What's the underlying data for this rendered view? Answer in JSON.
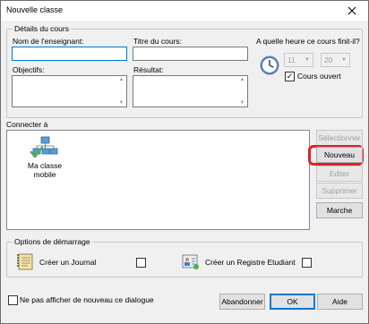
{
  "window": {
    "title": "Nouvelle classe",
    "close_icon": "close-icon"
  },
  "details": {
    "legend": "Détails du cours",
    "teacher_label": "Nom de l'enseignant:",
    "teacher_value": "",
    "course_title_label": "Titre du cours:",
    "course_title_value": "",
    "objectives_label": "Objectifs:",
    "objectives_value": "",
    "result_label": "Résultat:",
    "result_value": "",
    "end_time_label": "A quelle heure ce cours finit-il?",
    "hour_value": "11",
    "minute_value": "20",
    "course_open_label": "Cours ouvert",
    "course_open_checked": true
  },
  "connect": {
    "label": "Connecter à",
    "items": [
      {
        "label": "Ma classe mobile",
        "icon": "network-class-icon"
      }
    ]
  },
  "side_buttons": {
    "select": "Sélectionner",
    "new": "Nouveau",
    "edit": "Editer",
    "delete": "Supprimer",
    "start": "Marche"
  },
  "startup": {
    "legend": "Options de démarrage",
    "journal_label": "Créer un Journal",
    "journal_checked": false,
    "register_label": "Créer un Registre Etudiant",
    "register_checked": false
  },
  "footer": {
    "dont_show_label": "Ne pas afficher de nouveau ce dialogue",
    "dont_show_checked": false,
    "cancel": "Abandonner",
    "ok": "OK",
    "help": "Aide"
  },
  "colors": {
    "highlight": "#e0202a",
    "focus_border": "#0078d7"
  }
}
